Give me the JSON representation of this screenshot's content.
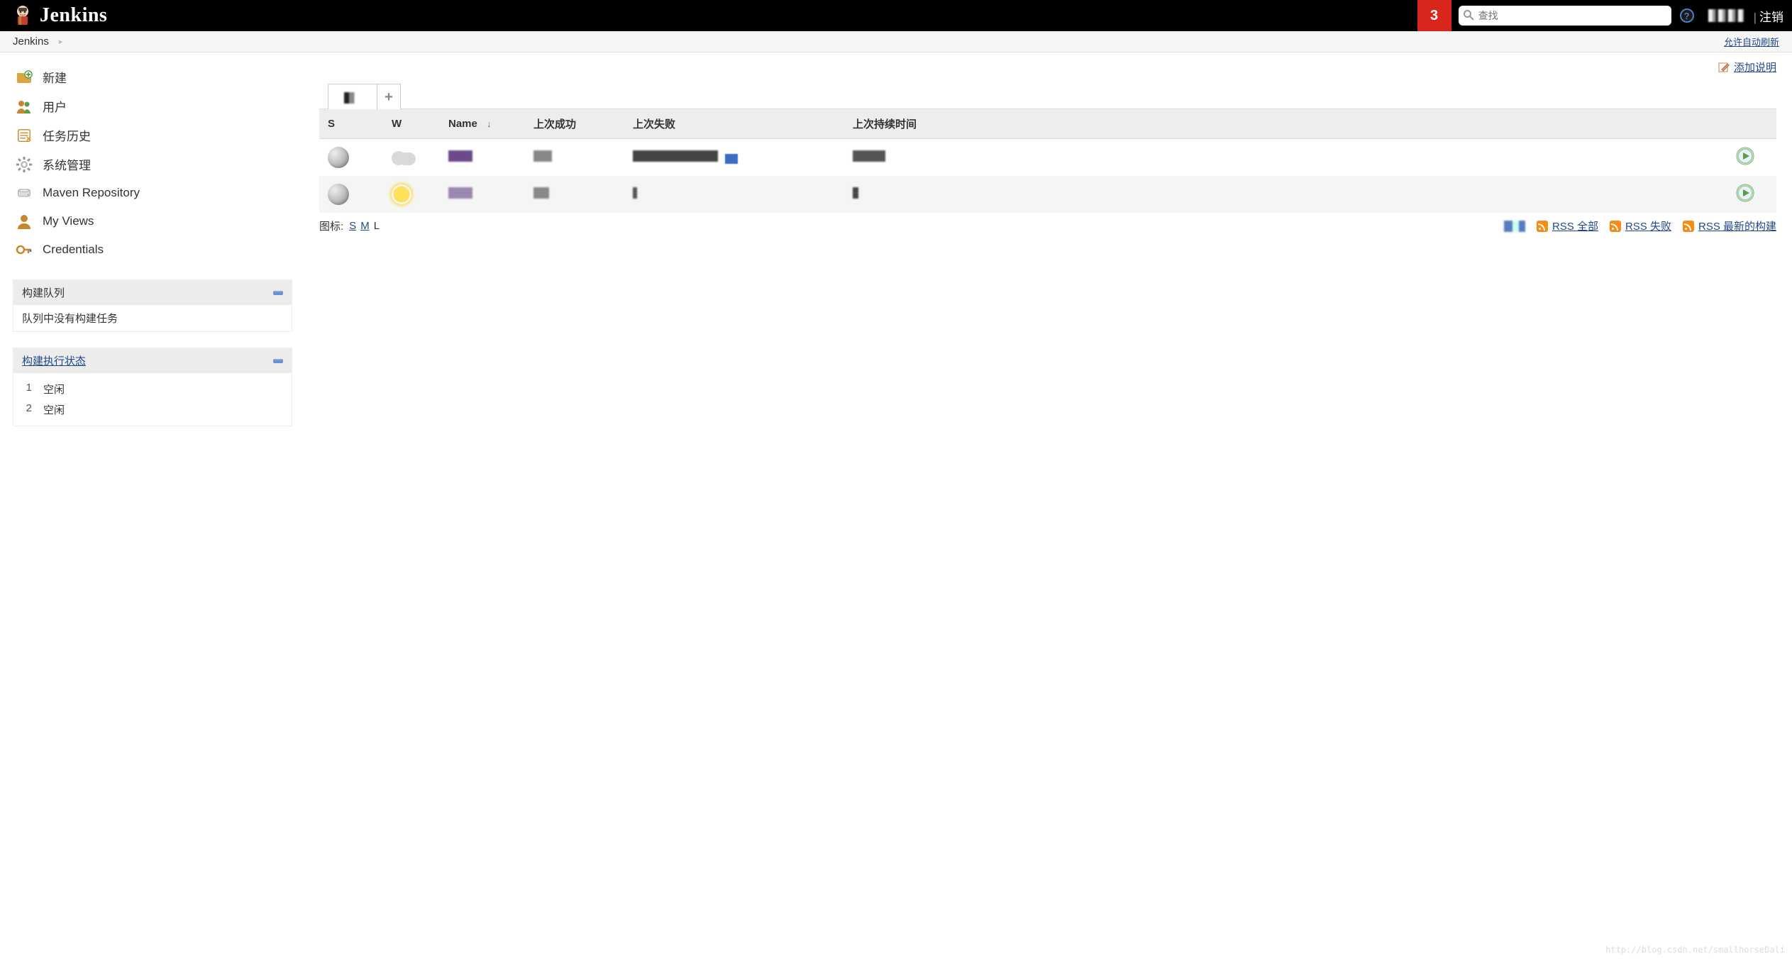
{
  "header": {
    "brand": "Jenkins",
    "notification_count": "3",
    "search_placeholder": "查找",
    "logout_label": "注销"
  },
  "breadcrumbs": {
    "items": [
      "Jenkins"
    ],
    "auto_refresh_label": "允许自动刷新"
  },
  "sidebar": {
    "items": [
      {
        "label": "新建"
      },
      {
        "label": "用户"
      },
      {
        "label": "任务历史"
      },
      {
        "label": "系统管理"
      },
      {
        "label": "Maven Repository"
      },
      {
        "label": "My Views"
      },
      {
        "label": "Credentials"
      }
    ],
    "build_queue": {
      "title": "构建队列",
      "empty_text": "队列中没有构建任务"
    },
    "executors": {
      "title": "构建执行状态",
      "rows": [
        {
          "num": "1",
          "status": "空闲"
        },
        {
          "num": "2",
          "status": "空闲"
        }
      ]
    }
  },
  "main": {
    "add_description_label": "添加说明",
    "table": {
      "columns": {
        "s": "S",
        "w": "W",
        "name": "Name",
        "last_success": "上次成功",
        "last_failure": "上次失败",
        "last_duration": "上次持续时间"
      },
      "rows": [
        {
          "status": "grey",
          "weather": "cloudy"
        },
        {
          "status": "grey",
          "weather": "sunny"
        }
      ]
    },
    "icon_size": {
      "label": "图标:",
      "options": [
        "S",
        "M",
        "L"
      ],
      "current": "L"
    },
    "rss": {
      "all": "RSS 全部",
      "failed": "RSS 失败",
      "latest": "RSS 最新的构建"
    }
  },
  "watermark": "http://blog.csdn.net/smallhorseDali"
}
